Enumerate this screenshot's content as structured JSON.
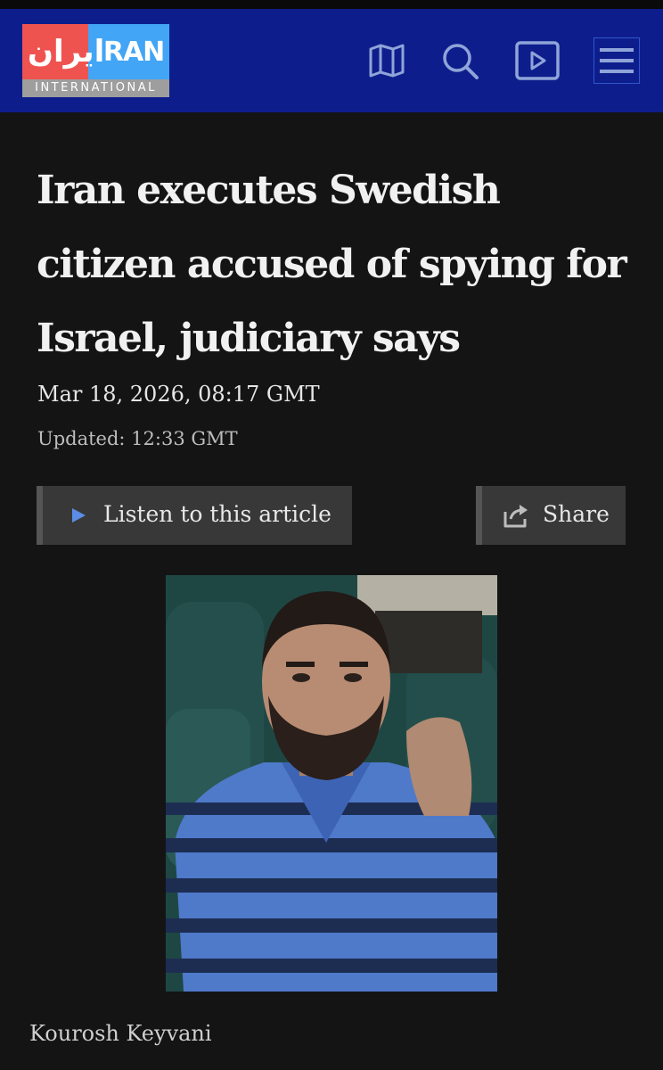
{
  "header": {
    "logo_farsi": "ایران",
    "logo_brand": "IRAN",
    "logo_sub": "INTERNATIONAL",
    "icons": [
      "map-icon",
      "search-icon",
      "video-play-icon",
      "hamburger-menu-icon"
    ]
  },
  "article": {
    "headline": "Iran executes Swedish citizen accused of spying for Israel, judiciary says",
    "date": "Mar 18, 2026, 08:17 GMT",
    "updated": "Updated: 12:33 GMT",
    "listen_label": "Listen to this article",
    "share_label": "Share",
    "photo_caption": "Kourosh Keyvani"
  },
  "colors": {
    "header_bg": "#0d1e8c",
    "page_bg": "#141414",
    "logo_red": "#ef5350",
    "logo_blue": "#42a5f5",
    "play_accent": "#5b8de6"
  }
}
